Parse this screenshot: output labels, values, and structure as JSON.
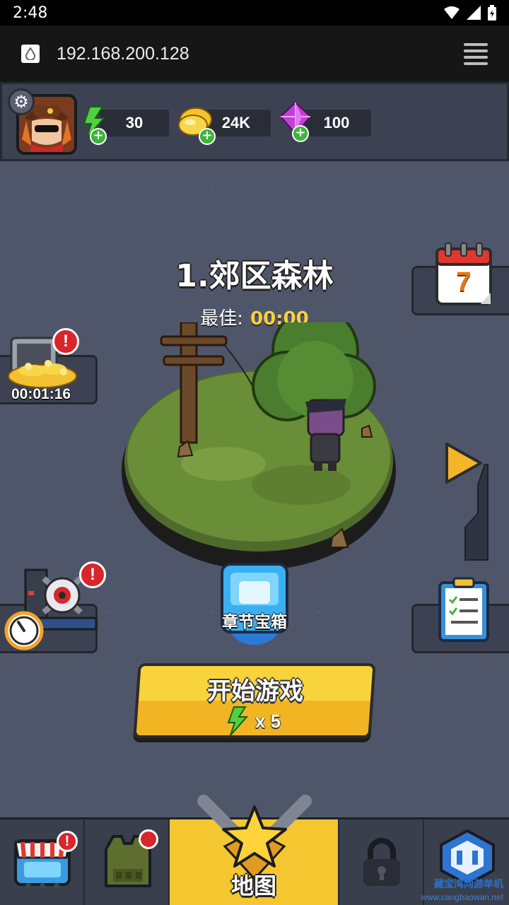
{
  "status_bar": {
    "time": "2:48"
  },
  "browser": {
    "url": "192.168.200.128"
  },
  "resources": {
    "energy": "30",
    "gold": "24K",
    "gems": "100"
  },
  "level": {
    "title": "1.郊区森林",
    "best_label": "最佳:",
    "best_value": "00:00"
  },
  "treasury": {
    "timer": "00:01:16"
  },
  "calendar": {
    "day": "7"
  },
  "chest": {
    "label": "章节宝箱"
  },
  "start_button": {
    "label": "开始游戏",
    "cost": "x 5"
  },
  "nav": {
    "map_label": "地图"
  },
  "watermark": {
    "cn": "藏宝湾网游单机",
    "url": "www.cangbaowan.net"
  },
  "colors": {
    "background": "#50566a",
    "panel": "#3d4252",
    "accent_yellow": "#f4c62f",
    "alert_red": "#d8262b",
    "energy_green": "#3fb33a"
  },
  "icons": [
    "settings-gear-icon",
    "energy-bolt-icon",
    "gold-coins-icon",
    "gem-icon",
    "calendar-icon",
    "treasury-icon",
    "radar-icon",
    "play-arrow-icon",
    "checklist-icon",
    "shop-icon",
    "armor-vest-icon",
    "map-star-icon",
    "lock-icon",
    "tech-icon"
  ]
}
